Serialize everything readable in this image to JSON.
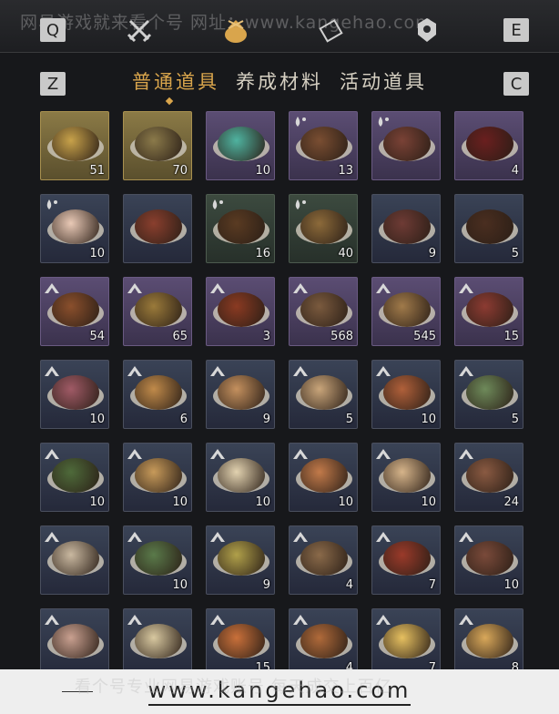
{
  "watermark_top": "网易游戏就来看个号 网址：www.kangehao.com",
  "keys": {
    "q": "Q",
    "e": "E",
    "z": "Z",
    "c": "C"
  },
  "top_icons": [
    "crossed-swords-icon",
    "pouch-icon",
    "scroll-icon",
    "gem-icon"
  ],
  "tabs": [
    {
      "label": "普通道具",
      "active": true
    },
    {
      "label": "养成材料",
      "active": false
    },
    {
      "label": "活动道具",
      "active": false
    }
  ],
  "items": [
    {
      "count": "51",
      "bg": "gold",
      "food": "#c8a24a",
      "badge": ""
    },
    {
      "count": "70",
      "bg": "gold",
      "food": "#8b7a4a",
      "badge": ""
    },
    {
      "count": "10",
      "bg": "purple",
      "food": "#4fb3a0",
      "badge": ""
    },
    {
      "count": "13",
      "bg": "purple",
      "food": "#7a4e32",
      "badge": "drop"
    },
    {
      "count": "",
      "bg": "purple",
      "food": "#7a4236",
      "badge": "drop"
    },
    {
      "count": "4",
      "bg": "purple",
      "food": "#6a1f1f",
      "badge": ""
    },
    {
      "count": "10",
      "bg": "blue",
      "food": "#e9c9b6",
      "badge": "drop"
    },
    {
      "count": "",
      "bg": "blue",
      "food": "#8a3f2e",
      "badge": ""
    },
    {
      "count": "16",
      "bg": "green",
      "food": "#5a3b22",
      "badge": "drop"
    },
    {
      "count": "40",
      "bg": "green",
      "food": "#8c6a3a",
      "badge": "drop"
    },
    {
      "count": "9",
      "bg": "blue",
      "food": "#6e3b35",
      "badge": ""
    },
    {
      "count": "5",
      "bg": "blue",
      "food": "#4a2e20",
      "badge": ""
    },
    {
      "count": "54",
      "bg": "purple",
      "food": "#8a4f2c",
      "badge": "up"
    },
    {
      "count": "65",
      "bg": "purple",
      "food": "#9a7a3a",
      "badge": "up"
    },
    {
      "count": "3",
      "bg": "purple",
      "food": "#8a3a22",
      "badge": "up"
    },
    {
      "count": "568",
      "bg": "purple",
      "food": "#7a5a3e",
      "badge": "up"
    },
    {
      "count": "545",
      "bg": "purple",
      "food": "#a07a4a",
      "badge": "up"
    },
    {
      "count": "15",
      "bg": "purple",
      "food": "#8c3b32",
      "badge": "up"
    },
    {
      "count": "10",
      "bg": "blue",
      "food": "#a05a66",
      "badge": "up"
    },
    {
      "count": "6",
      "bg": "blue",
      "food": "#c08a4a",
      "badge": "up"
    },
    {
      "count": "9",
      "bg": "blue",
      "food": "#c4905e",
      "badge": "up"
    },
    {
      "count": "5",
      "bg": "blue",
      "food": "#c9a57a",
      "badge": "up"
    },
    {
      "count": "10",
      "bg": "blue",
      "food": "#b0603a",
      "badge": "up"
    },
    {
      "count": "5",
      "bg": "blue",
      "food": "#6e8a5a",
      "badge": "up"
    },
    {
      "count": "10",
      "bg": "blue",
      "food": "#4e6a3a",
      "badge": "up"
    },
    {
      "count": "10",
      "bg": "blue",
      "food": "#c79a5a",
      "badge": "up"
    },
    {
      "count": "10",
      "bg": "blue",
      "food": "#e2d2b0",
      "badge": "up"
    },
    {
      "count": "10",
      "bg": "blue",
      "food": "#c27a4a",
      "badge": "up"
    },
    {
      "count": "10",
      "bg": "blue",
      "food": "#d6b48a",
      "badge": "up"
    },
    {
      "count": "24",
      "bg": "blue",
      "food": "#8a5a42",
      "badge": "up"
    },
    {
      "count": "",
      "bg": "blue",
      "food": "#c9b8a0",
      "badge": "up"
    },
    {
      "count": "10",
      "bg": "blue",
      "food": "#5a7a4a",
      "badge": "up"
    },
    {
      "count": "9",
      "bg": "blue",
      "food": "#b0a04a",
      "badge": "up"
    },
    {
      "count": "4",
      "bg": "blue",
      "food": "#8a6a4a",
      "badge": "up"
    },
    {
      "count": "7",
      "bg": "blue",
      "food": "#9a3a2a",
      "badge": "up"
    },
    {
      "count": "10",
      "bg": "blue",
      "food": "#7a4a3a",
      "badge": "up"
    },
    {
      "count": "",
      "bg": "blue",
      "food": "#c9a090",
      "badge": "up"
    },
    {
      "count": "",
      "bg": "blue",
      "food": "#d8c8a0",
      "badge": "up"
    },
    {
      "count": "15",
      "bg": "blue",
      "food": "#c9703a",
      "badge": "up"
    },
    {
      "count": "4",
      "bg": "blue",
      "food": "#b06a3a",
      "badge": "up"
    },
    {
      "count": "7",
      "bg": "blue",
      "food": "#e6c060",
      "badge": "up"
    },
    {
      "count": "8",
      "bg": "blue",
      "food": "#d9a85a",
      "badge": "up"
    }
  ],
  "footer_ghost": "看个号专业网易游戏账号   每天成交上百亿",
  "footer_url": "www.kangehao.com"
}
